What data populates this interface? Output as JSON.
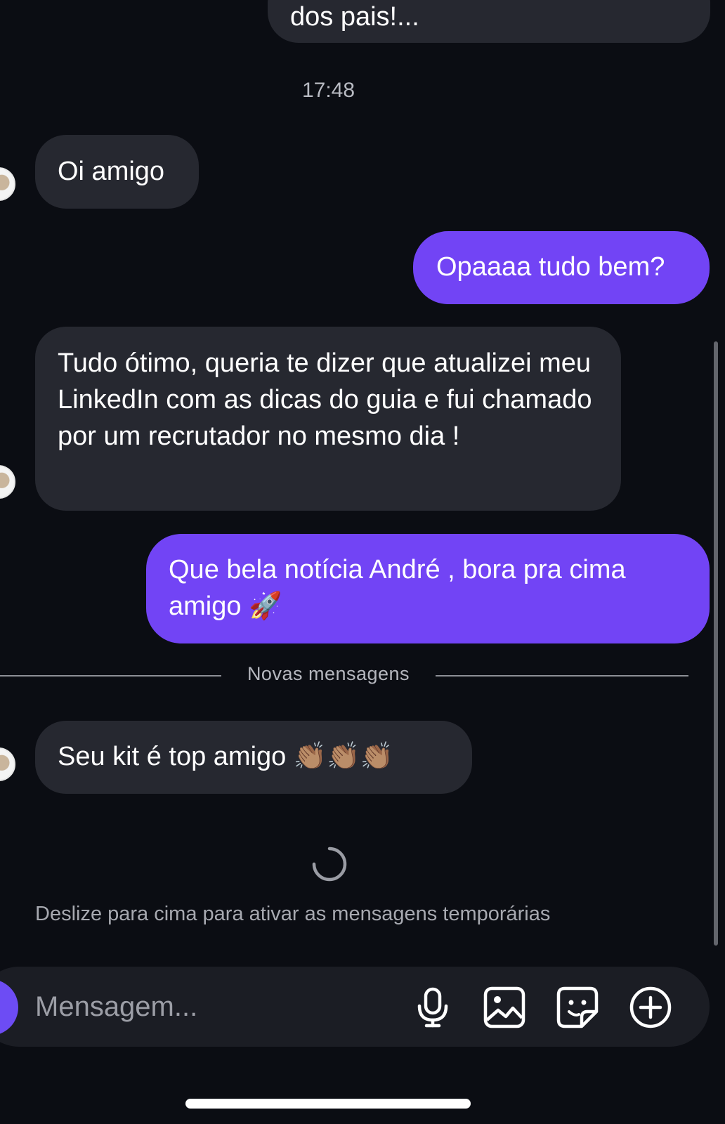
{
  "chat": {
    "previous_message_tail": "dos pais!...",
    "timestamp": "17:48",
    "messages": [
      {
        "direction": "incoming",
        "text": "Oi amigo"
      },
      {
        "direction": "outgoing",
        "text": "Opaaaa tudo bem?"
      },
      {
        "direction": "incoming",
        "text": "Tudo ótimo, queria te dizer que atualizei meu LinkedIn com as dicas do guia e fui chamado por um recrutador no mesmo dia !"
      },
      {
        "direction": "outgoing",
        "text": "Que bela notícia André , bora pra cima amigo 🚀"
      },
      {
        "direction": "incoming",
        "text": "Seu kit é top amigo 👏🏽👏🏽👏🏽"
      }
    ],
    "new_messages_divider": "Novas mensagens",
    "swipe_hint": "Deslize para cima para ativar as mensagens temporárias"
  },
  "composer": {
    "placeholder": "Mensagem...",
    "tools": [
      "camera-icon",
      "microphone-icon",
      "gallery-icon",
      "sticker-icon",
      "add-icon"
    ]
  },
  "colors": {
    "background": "#0b0d13",
    "incoming_bubble": "#262830",
    "outgoing_bubble": "#7244f5",
    "composer": "#1b1d24"
  }
}
